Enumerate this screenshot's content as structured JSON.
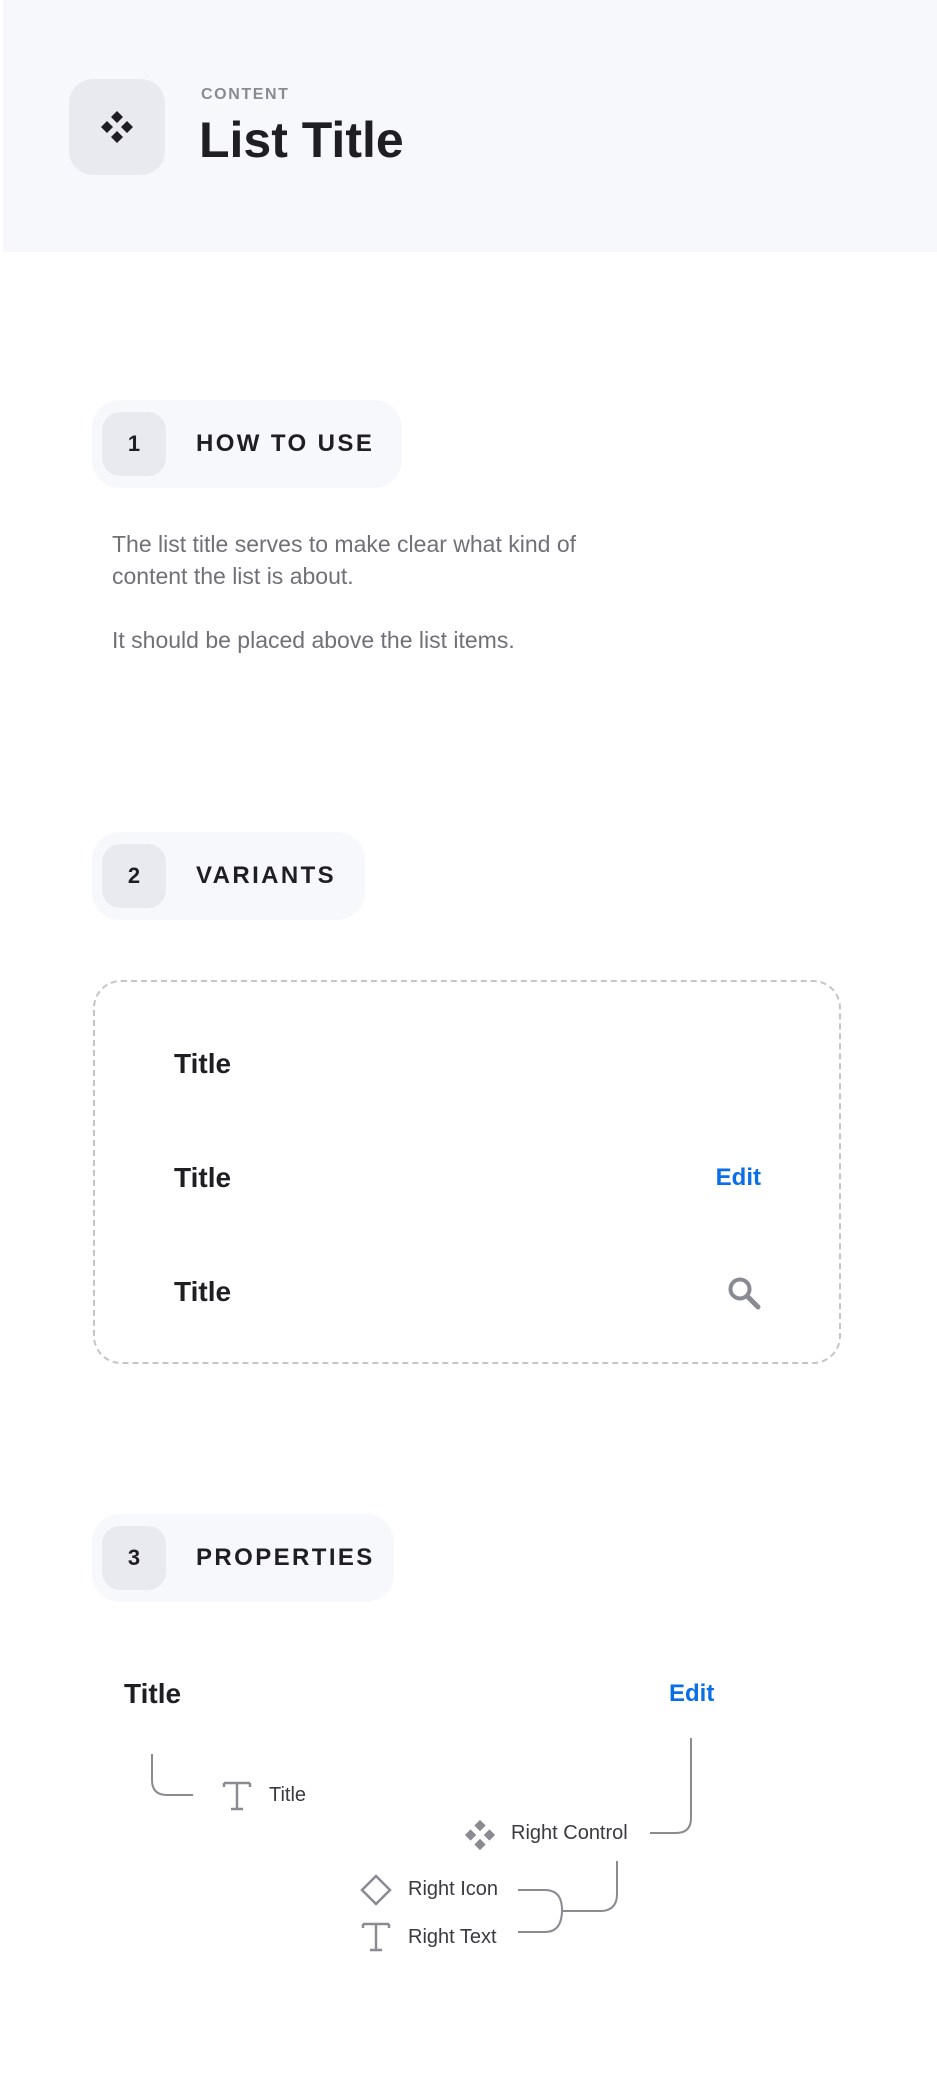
{
  "header": {
    "kicker": "CONTENT",
    "title": "List Title",
    "logo_icon": "component-icon"
  },
  "sections": [
    {
      "number": "1",
      "label": "HOW TO USE"
    },
    {
      "number": "2",
      "label": "VARIANTS"
    },
    {
      "number": "3",
      "label": "PROPERTIES"
    }
  ],
  "how_to_use": {
    "paragraphs": [
      "The list title serves to make clear what kind of content the list is about.",
      "It should be placed above the list items."
    ]
  },
  "variants": [
    {
      "title": "Title",
      "right": ""
    },
    {
      "title": "Title",
      "right": "Edit"
    },
    {
      "title": "Title",
      "right_icon": "search-icon"
    }
  ],
  "properties": {
    "title": "Title",
    "edit": "Edit",
    "labels": {
      "title": "Title",
      "right_control": "Right Control",
      "right_icon": "Right Icon",
      "right_text": "Right Text"
    },
    "icons": {
      "title": "text-icon",
      "right_control": "component-icon",
      "right_icon": "diamond-icon",
      "right_text": "text-icon"
    }
  },
  "colors": {
    "accent": "#0a6ee8",
    "header_bg": "#f7f8fc",
    "tile_bg": "#e9eaf0",
    "muted_text": "#707078"
  }
}
